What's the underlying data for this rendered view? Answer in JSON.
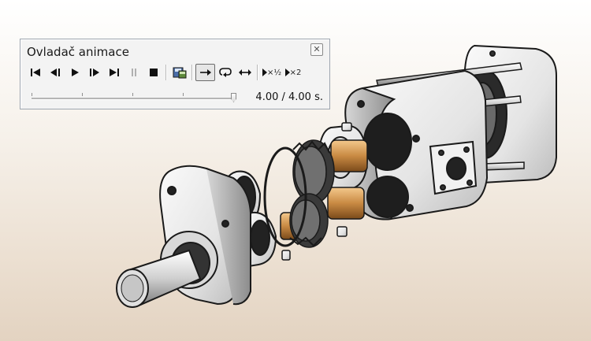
{
  "panel": {
    "title": "Ovladač animace",
    "time_readout": "4.00 / 4.00 s.",
    "playback_position_fraction": 1.0,
    "mode_active": "play-once",
    "speed_half_label": "×½",
    "speed_double_label": "×2",
    "icons": [
      "rewind-to-start-icon",
      "step-back-icon",
      "play-icon",
      "step-forward-icon",
      "fast-forward-to-end-icon",
      "pause-icon",
      "stop-icon",
      "save-animation-icon",
      "play-once-icon",
      "loop-icon",
      "reciprocate-icon",
      "half-speed-icon",
      "double-speed-icon"
    ]
  },
  "colors": {
    "panel_bg": "#f3f3f3",
    "metal": "#e6e6e6",
    "copper": "#c98a43",
    "outline": "#1a1a1a"
  }
}
